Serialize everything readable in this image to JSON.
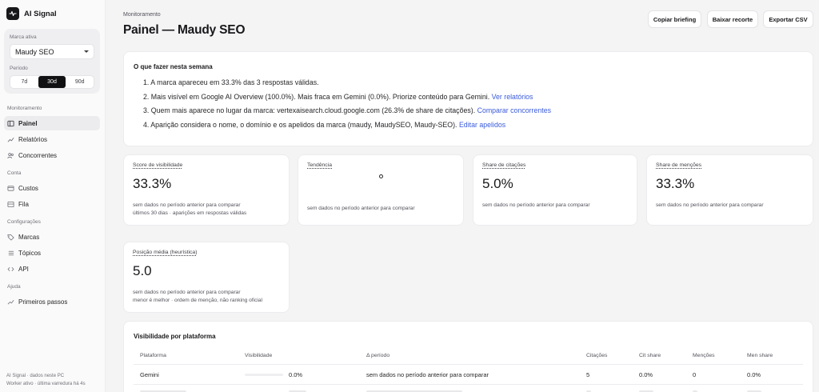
{
  "app": {
    "name": "AI Signal"
  },
  "sidebar": {
    "brand_label": "Marca ativa",
    "brand_value": "Maudy SEO",
    "period_label": "Período",
    "periods": [
      "7d",
      "30d",
      "90d"
    ],
    "active_period": "30d",
    "sections": [
      {
        "title": "Monitoramento",
        "items": [
          "Painel",
          "Relatórios",
          "Concorrentes"
        ]
      },
      {
        "title": "Conta",
        "items": [
          "Custos",
          "Fila"
        ]
      },
      {
        "title": "Configurações",
        "items": [
          "Marcas",
          "Tópicos",
          "API"
        ]
      },
      {
        "title": "Ajuda",
        "items": [
          "Primeiros passos"
        ]
      }
    ],
    "footer_line1": "AI Signal · dados neste PC",
    "footer_line2": "Worker ativo · última varredura há 4s"
  },
  "header": {
    "breadcrumb": "Monitoramento",
    "title": "Painel — Maudy SEO",
    "buttons": [
      "Copiar briefing",
      "Baixar recorte",
      "Exportar CSV"
    ]
  },
  "week": {
    "title": "O que fazer nesta semana",
    "items": [
      {
        "text": "1. A marca apareceu em 33.3% das 3 respostas válidas.",
        "link": ""
      },
      {
        "text": "2. Mais visível em Google AI Overview (100.0%). Mais fraca em Gemini (0.0%). Priorize conteúdo para Gemini.",
        "link": "Ver relatórios"
      },
      {
        "text": "3. Quem mais aparece no lugar da marca: vertexaisearch.cloud.google.com (26.3% de share de citações).",
        "link": "Comparar concorrentes"
      },
      {
        "text": "4. Aparição considera o nome, o domínio e os apelidos da marca (maudy, MaudySEO, Maudy-SEO).",
        "link": "Editar apelidos"
      }
    ]
  },
  "metrics": [
    {
      "label": "Score de visibilidade",
      "value": "33.3%",
      "sub1": "sem dados no período anterior para comparar",
      "sub2": "últimos 30 dias · aparições em respostas válidas"
    },
    {
      "label": "Tendência",
      "value": "",
      "sub1": "sem dados no período anterior para comparar",
      "sub2": ""
    },
    {
      "label": "Share de citações",
      "value": "5.0%",
      "sub1": "sem dados no período anterior para comparar",
      "sub2": ""
    },
    {
      "label": "Share de menções",
      "value": "33.3%",
      "sub1": "sem dados no período anterior para comparar",
      "sub2": ""
    },
    {
      "label": "Posição média (heurística)",
      "value": "5.0",
      "sub1": "sem dados no período anterior para comparar",
      "sub2": "menor é melhor · ordem de menção, não ranking oficial"
    }
  ],
  "platform_table": {
    "title": "Visibilidade por plataforma",
    "columns": [
      "Plataforma",
      "Visibilidade",
      "Δ período",
      "Citações",
      "Cit share",
      "Menções",
      "Men share"
    ],
    "rows": [
      {
        "platform": "Gemini",
        "visibility": "0.0%",
        "visibility_fraction": 0.0,
        "delta": "sem dados no período anterior para comparar",
        "citations": "5",
        "cit_share": "0.0%",
        "mentions": "0",
        "men_share": "0.0%"
      }
    ]
  },
  "colors": {
    "accent": "#18181b",
    "link": "#3b5bdb",
    "background": "#f4f4f5"
  }
}
